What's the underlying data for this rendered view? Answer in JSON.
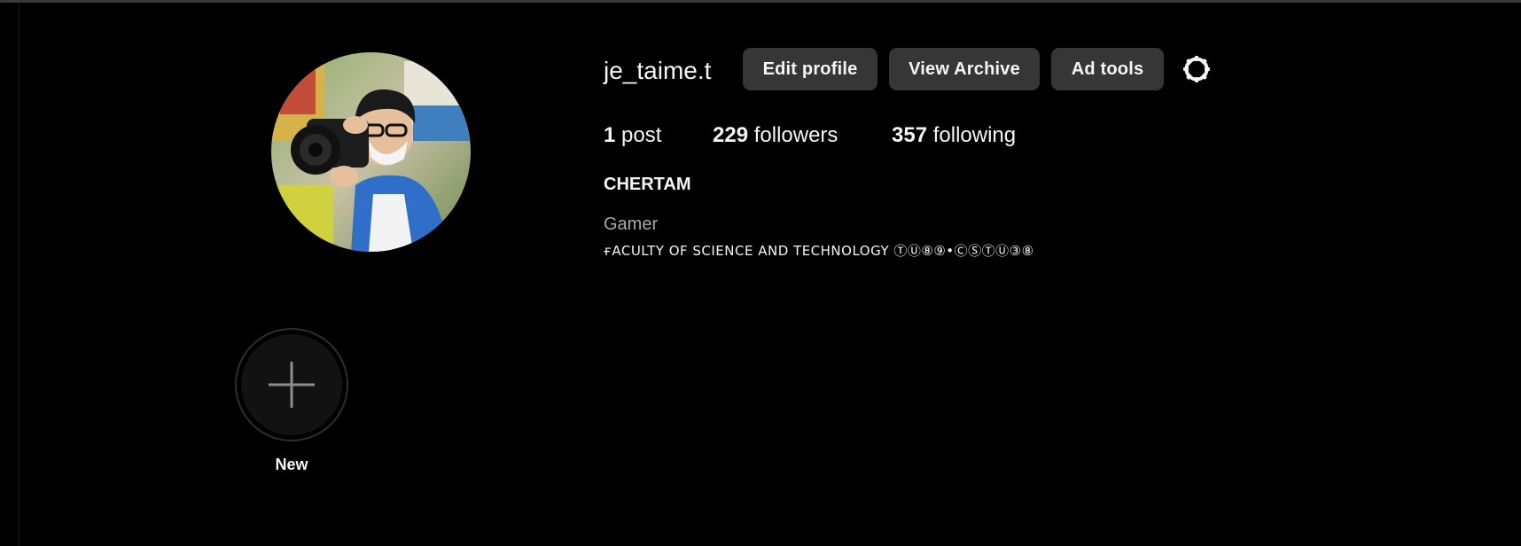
{
  "profile": {
    "username": "je_taime.t",
    "full_name": "CHERTAM",
    "category": "Gamer",
    "bio": "ғACULTY OF SCIENCE AND TECHNOLOGY ⓉⓊ⑧⑨•ⒸⓈⓉⓊ③⑧"
  },
  "buttons": {
    "edit_profile": "Edit profile",
    "view_archive": "View Archive",
    "ad_tools": "Ad tools"
  },
  "stats": {
    "posts_count": "1",
    "posts_label": "post",
    "followers_count": "229",
    "followers_label": "followers",
    "following_count": "357",
    "following_label": "following"
  },
  "highlights": {
    "new_label": "New"
  },
  "icons": {
    "settings": "gear-icon",
    "new_highlight": "plus-icon",
    "avatar": "profile-photo"
  },
  "colors": {
    "background": "#000000",
    "button_bg": "#363636",
    "text_primary": "#f5f5f5",
    "text_secondary": "#a8a8a8"
  }
}
